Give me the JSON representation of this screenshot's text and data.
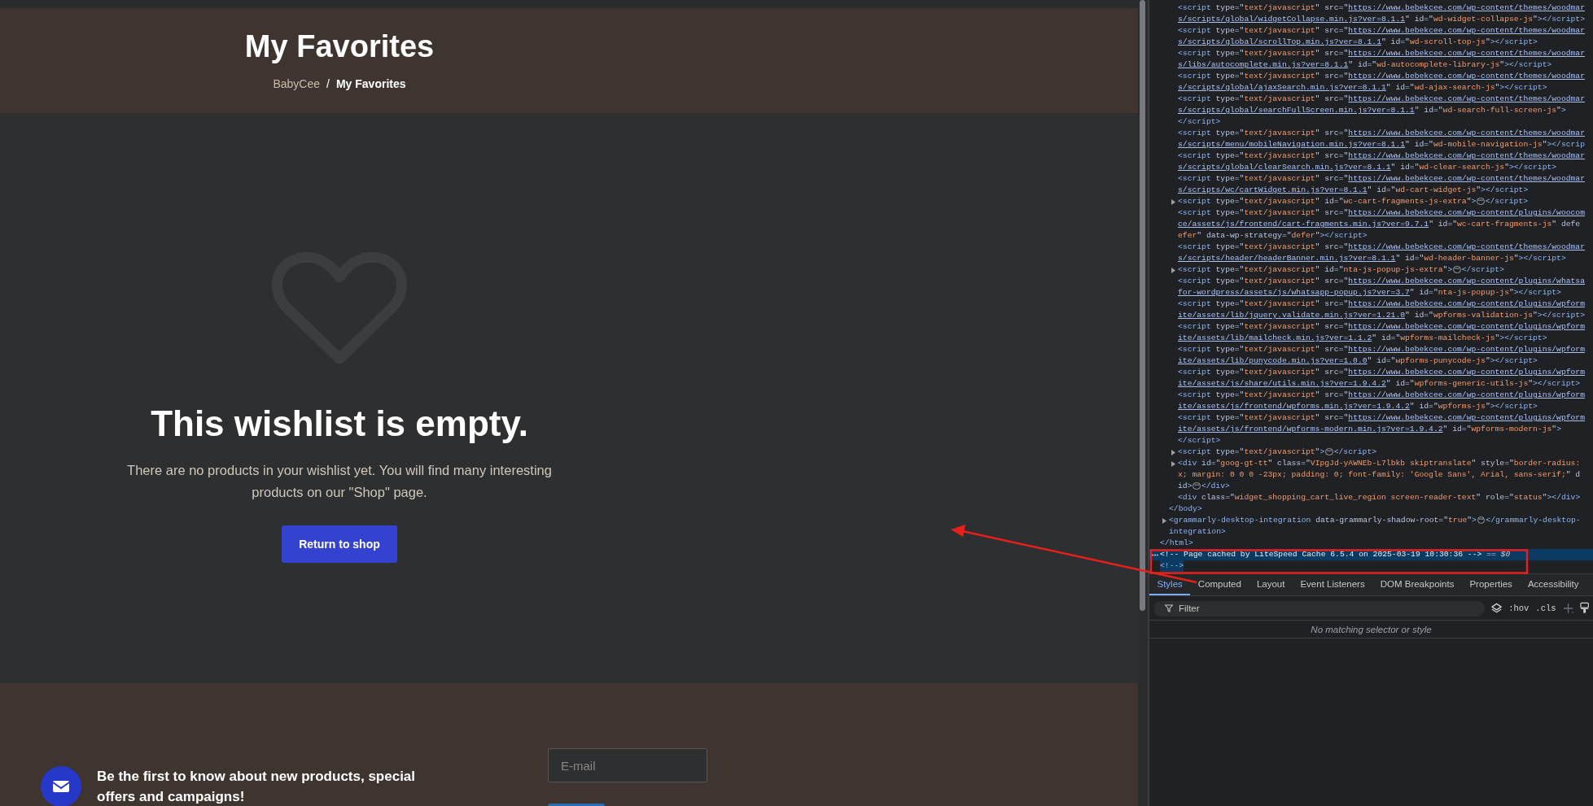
{
  "page": {
    "header": {
      "title": "My Favorites",
      "breadcrumb": [
        {
          "label": "BabyCee",
          "current": false
        },
        {
          "label": "My Favorites",
          "current": true
        }
      ],
      "breadcrumb_separator": "/"
    },
    "empty_state": {
      "heading": "This wishlist is empty.",
      "message": "There are no products in your wishlist yet. You will find many interesting products on our \"Shop\" page.",
      "button": "Return to shop"
    },
    "newsletter": {
      "text": "Be the first to know about new products, special offers and campaigns!",
      "email_placeholder": "E-mail"
    }
  },
  "devtools": {
    "dom_tree": [
      {
        "children": [
          {
            "children": [
              {
                "selected": false,
                "lines": [
                  [
                    {
                      "kind": "tag",
                      "t": "<script"
                    },
                    {
                      "kind": "attr",
                      "t": " type=\""
                    },
                    {
                      "kind": "val",
                      "t": "text/javascript"
                    },
                    {
                      "kind": "attr",
                      "t": "\" src=\""
                    },
                    {
                      "kind": "link",
                      "t": "https://www.bebekcee.com/wp-content/themes/woodmar"
                    }
                  ],
                  [
                    {
                      "kind": "link",
                      "t": "s/scripts/global/widgetCollapse.min.js?ver=8.1.1"
                    },
                    {
                      "kind": "attr",
                      "t": "\" id=\""
                    },
                    {
                      "kind": "val",
                      "t": "wd-widget-collapse-js"
                    },
                    {
                      "kind": "attr",
                      "t": "\""
                    },
                    {
                      "kind": "tag",
                      "t": "></script>"
                    }
                  ]
                ]
              },
              {
                "selected": false,
                "lines": [
                  [
                    {
                      "kind": "tag",
                      "t": "<script"
                    },
                    {
                      "kind": "attr",
                      "t": " type=\""
                    },
                    {
                      "kind": "val",
                      "t": "text/javascript"
                    },
                    {
                      "kind": "attr",
                      "t": "\" src=\""
                    },
                    {
                      "kind": "link",
                      "t": "https://www.bebekcee.com/wp-content/themes/woodmar"
                    }
                  ],
                  [
                    {
                      "kind": "link",
                      "t": "s/scripts/global/scrollTop.min.js?ver=8.1.1"
                    },
                    {
                      "kind": "attr",
                      "t": "\" id=\""
                    },
                    {
                      "kind": "val",
                      "t": "wd-scroll-top-js"
                    },
                    {
                      "kind": "attr",
                      "t": "\""
                    },
                    {
                      "kind": "tag",
                      "t": "></script>"
                    }
                  ]
                ]
              },
              {
                "selected": false,
                "lines": [
                  [
                    {
                      "kind": "tag",
                      "t": "<script"
                    },
                    {
                      "kind": "attr",
                      "t": " type=\""
                    },
                    {
                      "kind": "val",
                      "t": "text/javascript"
                    },
                    {
                      "kind": "attr",
                      "t": "\" src=\""
                    },
                    {
                      "kind": "link",
                      "t": "https://www.bebekcee.com/wp-content/themes/woodmar"
                    }
                  ],
                  [
                    {
                      "kind": "link",
                      "t": "s/libs/autocomplete.min.js?ver=8.1.1"
                    },
                    {
                      "kind": "attr",
                      "t": "\" id=\""
                    },
                    {
                      "kind": "val",
                      "t": "wd-autocomplete-library-js"
                    },
                    {
                      "kind": "attr",
                      "t": "\""
                    },
                    {
                      "kind": "tag",
                      "t": "></script>"
                    }
                  ]
                ]
              },
              {
                "selected": false,
                "lines": [
                  [
                    {
                      "kind": "tag",
                      "t": "<script"
                    },
                    {
                      "kind": "attr",
                      "t": " type=\""
                    },
                    {
                      "kind": "val",
                      "t": "text/javascript"
                    },
                    {
                      "kind": "attr",
                      "t": "\" src=\""
                    },
                    {
                      "kind": "link",
                      "t": "https://www.bebekcee.com/wp-content/themes/woodmar"
                    }
                  ],
                  [
                    {
                      "kind": "link",
                      "t": "s/scripts/global/ajaxSearch.min.js?ver=8.1.1"
                    },
                    {
                      "kind": "attr",
                      "t": "\" id=\""
                    },
                    {
                      "kind": "val",
                      "t": "wd-ajax-search-js"
                    },
                    {
                      "kind": "attr",
                      "t": "\""
                    },
                    {
                      "kind": "tag",
                      "t": "></script>"
                    }
                  ]
                ]
              },
              {
                "selected": false,
                "lines": [
                  [
                    {
                      "kind": "tag",
                      "t": "<script"
                    },
                    {
                      "kind": "attr",
                      "t": " type=\""
                    },
                    {
                      "kind": "val",
                      "t": "text/javascript"
                    },
                    {
                      "kind": "attr",
                      "t": "\" src=\""
                    },
                    {
                      "kind": "link",
                      "t": "https://www.bebekcee.com/wp-content/themes/woodmar"
                    }
                  ],
                  [
                    {
                      "kind": "link",
                      "t": "s/scripts/global/searchFullScreen.min.js?ver=8.1.1"
                    },
                    {
                      "kind": "attr",
                      "t": "\" id=\""
                    },
                    {
                      "kind": "val",
                      "t": "wd-search-full-screen-js"
                    },
                    {
                      "kind": "attr",
                      "t": "\""
                    },
                    {
                      "kind": "tag",
                      "t": ">"
                    }
                  ],
                  [
                    {
                      "kind": "tag",
                      "t": "</script>"
                    }
                  ]
                ]
              },
              {
                "selected": false,
                "lines": [
                  [
                    {
                      "kind": "tag",
                      "t": "<script"
                    },
                    {
                      "kind": "attr",
                      "t": " type=\""
                    },
                    {
                      "kind": "val",
                      "t": "text/javascript"
                    },
                    {
                      "kind": "attr",
                      "t": "\" src=\""
                    },
                    {
                      "kind": "link",
                      "t": "https://www.bebekcee.com/wp-content/themes/woodmar"
                    }
                  ],
                  [
                    {
                      "kind": "link",
                      "t": "s/scripts/menu/mobileNavigation.min.js?ver=8.1.1"
                    },
                    {
                      "kind": "attr",
                      "t": "\" id=\""
                    },
                    {
                      "kind": "val",
                      "t": "wd-mobile-navigation-js"
                    },
                    {
                      "kind": "attr",
                      "t": "\""
                    },
                    {
                      "kind": "tag",
                      "t": "></scrip"
                    }
                  ]
                ]
              },
              {
                "selected": false,
                "lines": [
                  [
                    {
                      "kind": "tag",
                      "t": "<script"
                    },
                    {
                      "kind": "attr",
                      "t": " type=\""
                    },
                    {
                      "kind": "val",
                      "t": "text/javascript"
                    },
                    {
                      "kind": "attr",
                      "t": "\" src=\""
                    },
                    {
                      "kind": "link",
                      "t": "https://www.bebekcee.com/wp-content/themes/woodmar"
                    }
                  ],
                  [
                    {
                      "kind": "link",
                      "t": "s/scripts/global/clearSearch.min.js?ver=8.1.1"
                    },
                    {
                      "kind": "attr",
                      "t": "\" id=\""
                    },
                    {
                      "kind": "val",
                      "t": "wd-clear-search-js"
                    },
                    {
                      "kind": "attr",
                      "t": "\""
                    },
                    {
                      "kind": "tag",
                      "t": "></script>"
                    }
                  ]
                ]
              },
              {
                "selected": false,
                "lines": [
                  [
                    {
                      "kind": "tag",
                      "t": "<script"
                    },
                    {
                      "kind": "attr",
                      "t": " type=\""
                    },
                    {
                      "kind": "val",
                      "t": "text/javascript"
                    },
                    {
                      "kind": "attr",
                      "t": "\" src=\""
                    },
                    {
                      "kind": "link",
                      "t": "https://www.bebekcee.com/wp-content/themes/woodmar"
                    }
                  ],
                  [
                    {
                      "kind": "link",
                      "t": "s/scripts/wc/cartWidget.min.js?ver=8.1.1"
                    },
                    {
                      "kind": "attr",
                      "t": "\" id=\""
                    },
                    {
                      "kind": "val",
                      "t": "wd-cart-widget-js"
                    },
                    {
                      "kind": "attr",
                      "t": "\""
                    },
                    {
                      "kind": "tag",
                      "t": "></script>"
                    }
                  ]
                ]
              },
              {
                "selected": false,
                "expanded": false,
                "lines": [
                  [
                    {
                      "kind": "tag",
                      "t": "<script"
                    },
                    {
                      "kind": "attr",
                      "t": " type=\""
                    },
                    {
                      "kind": "val",
                      "t": "text/javascript"
                    },
                    {
                      "kind": "attr",
                      "t": "\" id=\""
                    },
                    {
                      "kind": "val",
                      "t": "wc-cart-fragments-js-extra"
                    },
                    {
                      "kind": "attr",
                      "t": "\""
                    },
                    {
                      "kind": "tag",
                      "t": ">"
                    },
                    {
                      "kind": "more",
                      "t": "⋯"
                    },
                    {
                      "kind": "tag",
                      "t": "</script>"
                    }
                  ]
                ]
              },
              {
                "selected": false,
                "lines": [
                  [
                    {
                      "kind": "tag",
                      "t": "<script"
                    },
                    {
                      "kind": "attr",
                      "t": " type=\""
                    },
                    {
                      "kind": "val",
                      "t": "text/javascript"
                    },
                    {
                      "kind": "attr",
                      "t": "\" src=\""
                    },
                    {
                      "kind": "link",
                      "t": "https://www.bebekcee.com/wp-content/plugins/woocom"
                    }
                  ],
                  [
                    {
                      "kind": "link",
                      "t": "ce/assets/js/frontend/cart-fragments.min.js?ver=9.7.1"
                    },
                    {
                      "kind": "attr",
                      "t": "\" id=\""
                    },
                    {
                      "kind": "val",
                      "t": "wc-cart-fragments-js"
                    },
                    {
                      "kind": "attr",
                      "t": "\" defe"
                    }
                  ],
                  [
                    {
                      "kind": "val",
                      "t": "efer"
                    },
                    {
                      "kind": "attr",
                      "t": "\" data-wp-strategy=\""
                    },
                    {
                      "kind": "val",
                      "t": "defer"
                    },
                    {
                      "kind": "attr",
                      "t": "\""
                    },
                    {
                      "kind": "tag",
                      "t": "></script>"
                    }
                  ]
                ]
              },
              {
                "selected": false,
                "lines": [
                  [
                    {
                      "kind": "tag",
                      "t": "<script"
                    },
                    {
                      "kind": "attr",
                      "t": " type=\""
                    },
                    {
                      "kind": "val",
                      "t": "text/javascript"
                    },
                    {
                      "kind": "attr",
                      "t": "\" src=\""
                    },
                    {
                      "kind": "link",
                      "t": "https://www.bebekcee.com/wp-content/themes/woodmar"
                    }
                  ],
                  [
                    {
                      "kind": "link",
                      "t": "s/scripts/header/headerBanner.min.js?ver=8.1.1"
                    },
                    {
                      "kind": "attr",
                      "t": "\" id=\""
                    },
                    {
                      "kind": "val",
                      "t": "wd-header-banner-js"
                    },
                    {
                      "kind": "attr",
                      "t": "\""
                    },
                    {
                      "kind": "tag",
                      "t": "></script>"
                    }
                  ]
                ]
              },
              {
                "selected": false,
                "expanded": false,
                "lines": [
                  [
                    {
                      "kind": "tag",
                      "t": "<script"
                    },
                    {
                      "kind": "attr",
                      "t": " type=\""
                    },
                    {
                      "kind": "val",
                      "t": "text/javascript"
                    },
                    {
                      "kind": "attr",
                      "t": "\" id=\""
                    },
                    {
                      "kind": "val",
                      "t": "nta-js-popup-js-extra"
                    },
                    {
                      "kind": "attr",
                      "t": "\""
                    },
                    {
                      "kind": "tag",
                      "t": ">"
                    },
                    {
                      "kind": "more",
                      "t": "⋯"
                    },
                    {
                      "kind": "tag",
                      "t": "</script>"
                    }
                  ]
                ]
              },
              {
                "selected": false,
                "lines": [
                  [
                    {
                      "kind": "tag",
                      "t": "<script"
                    },
                    {
                      "kind": "attr",
                      "t": " type=\""
                    },
                    {
                      "kind": "val",
                      "t": "text/javascript"
                    },
                    {
                      "kind": "attr",
                      "t": "\" src=\""
                    },
                    {
                      "kind": "link",
                      "t": "https://www.bebekcee.com/wp-content/plugins/whatsa"
                    }
                  ],
                  [
                    {
                      "kind": "link",
                      "t": "for-wordpress/assets/js/whatsapp-popup.js?ver=3.7"
                    },
                    {
                      "kind": "attr",
                      "t": "\" id=\""
                    },
                    {
                      "kind": "val",
                      "t": "nta-js-popup-js"
                    },
                    {
                      "kind": "attr",
                      "t": "\""
                    },
                    {
                      "kind": "tag",
                      "t": "></script>"
                    }
                  ]
                ]
              },
              {
                "selected": false,
                "lines": [
                  [
                    {
                      "kind": "tag",
                      "t": "<script"
                    },
                    {
                      "kind": "attr",
                      "t": " type=\""
                    },
                    {
                      "kind": "val",
                      "t": "text/javascript"
                    },
                    {
                      "kind": "attr",
                      "t": "\" src=\""
                    },
                    {
                      "kind": "link",
                      "t": "https://www.bebekcee.com/wp-content/plugins/wpform"
                    }
                  ],
                  [
                    {
                      "kind": "link",
                      "t": "ite/assets/lib/jquery.validate.min.js?ver=1.21.0"
                    },
                    {
                      "kind": "attr",
                      "t": "\" id=\""
                    },
                    {
                      "kind": "val",
                      "t": "wpforms-validation-js"
                    },
                    {
                      "kind": "attr",
                      "t": "\""
                    },
                    {
                      "kind": "tag",
                      "t": "></script>"
                    }
                  ]
                ]
              },
              {
                "selected": false,
                "lines": [
                  [
                    {
                      "kind": "tag",
                      "t": "<script"
                    },
                    {
                      "kind": "attr",
                      "t": " type=\""
                    },
                    {
                      "kind": "val",
                      "t": "text/javascript"
                    },
                    {
                      "kind": "attr",
                      "t": "\" src=\""
                    },
                    {
                      "kind": "link",
                      "t": "https://www.bebekcee.com/wp-content/plugins/wpform"
                    }
                  ],
                  [
                    {
                      "kind": "link",
                      "t": "ite/assets/lib/mailcheck.min.js?ver=1.1.2"
                    },
                    {
                      "kind": "attr",
                      "t": "\" id=\""
                    },
                    {
                      "kind": "val",
                      "t": "wpforms-mailcheck-js"
                    },
                    {
                      "kind": "attr",
                      "t": "\""
                    },
                    {
                      "kind": "tag",
                      "t": "></script>"
                    }
                  ]
                ]
              },
              {
                "selected": false,
                "lines": [
                  [
                    {
                      "kind": "tag",
                      "t": "<script"
                    },
                    {
                      "kind": "attr",
                      "t": " type=\""
                    },
                    {
                      "kind": "val",
                      "t": "text/javascript"
                    },
                    {
                      "kind": "attr",
                      "t": "\" src=\""
                    },
                    {
                      "kind": "link",
                      "t": "https://www.bebekcee.com/wp-content/plugins/wpform"
                    }
                  ],
                  [
                    {
                      "kind": "link",
                      "t": "ite/assets/lib/punycode.min.js?ver=1.0.0"
                    },
                    {
                      "kind": "attr",
                      "t": "\" id=\""
                    },
                    {
                      "kind": "val",
                      "t": "wpforms-punycode-js"
                    },
                    {
                      "kind": "attr",
                      "t": "\""
                    },
                    {
                      "kind": "tag",
                      "t": "></script>"
                    }
                  ]
                ]
              },
              {
                "selected": false,
                "lines": [
                  [
                    {
                      "kind": "tag",
                      "t": "<script"
                    },
                    {
                      "kind": "attr",
                      "t": " type=\""
                    },
                    {
                      "kind": "val",
                      "t": "text/javascript"
                    },
                    {
                      "kind": "attr",
                      "t": "\" src=\""
                    },
                    {
                      "kind": "link",
                      "t": "https://www.bebekcee.com/wp-content/plugins/wpform"
                    }
                  ],
                  [
                    {
                      "kind": "link",
                      "t": "ite/assets/js/share/utils.min.js?ver=1.9.4.2"
                    },
                    {
                      "kind": "attr",
                      "t": "\" id=\""
                    },
                    {
                      "kind": "val",
                      "t": "wpforms-generic-utils-js"
                    },
                    {
                      "kind": "attr",
                      "t": "\""
                    },
                    {
                      "kind": "tag",
                      "t": "></script>"
                    }
                  ]
                ]
              },
              {
                "selected": false,
                "lines": [
                  [
                    {
                      "kind": "tag",
                      "t": "<script"
                    },
                    {
                      "kind": "attr",
                      "t": " type=\""
                    },
                    {
                      "kind": "val",
                      "t": "text/javascript"
                    },
                    {
                      "kind": "attr",
                      "t": "\" src=\""
                    },
                    {
                      "kind": "link",
                      "t": "https://www.bebekcee.com/wp-content/plugins/wpform"
                    }
                  ],
                  [
                    {
                      "kind": "link",
                      "t": "ite/assets/js/frontend/wpforms.min.js?ver=1.9.4.2"
                    },
                    {
                      "kind": "attr",
                      "t": "\" id=\""
                    },
                    {
                      "kind": "val",
                      "t": "wpforms-js"
                    },
                    {
                      "kind": "attr",
                      "t": "\""
                    },
                    {
                      "kind": "tag",
                      "t": "></script>"
                    }
                  ]
                ]
              },
              {
                "selected": false,
                "lines": [
                  [
                    {
                      "kind": "tag",
                      "t": "<script"
                    },
                    {
                      "kind": "attr",
                      "t": " type=\""
                    },
                    {
                      "kind": "val",
                      "t": "text/javascript"
                    },
                    {
                      "kind": "attr",
                      "t": "\" src=\""
                    },
                    {
                      "kind": "link",
                      "t": "https://www.bebekcee.com/wp-content/plugins/wpform"
                    }
                  ],
                  [
                    {
                      "kind": "link",
                      "t": "ite/assets/js/frontend/wpforms-modern.min.js?ver=1.9.4.2"
                    },
                    {
                      "kind": "attr",
                      "t": "\" id=\""
                    },
                    {
                      "kind": "val",
                      "t": "wpforms-modern-js"
                    },
                    {
                      "kind": "attr",
                      "t": "\""
                    },
                    {
                      "kind": "tag",
                      "t": ">"
                    }
                  ],
                  [
                    {
                      "kind": "tag",
                      "t": "</script>"
                    }
                  ]
                ]
              },
              {
                "selected": false,
                "expanded": false,
                "lines": [
                  [
                    {
                      "kind": "tag",
                      "t": "<script"
                    },
                    {
                      "kind": "attr",
                      "t": " type=\""
                    },
                    {
                      "kind": "val",
                      "t": "text/javascript"
                    },
                    {
                      "kind": "attr",
                      "t": "\""
                    },
                    {
                      "kind": "tag",
                      "t": ">"
                    },
                    {
                      "kind": "more",
                      "t": "⋯"
                    },
                    {
                      "kind": "tag",
                      "t": "</script>"
                    }
                  ]
                ]
              },
              {
                "selected": false,
                "expanded": false,
                "lines": [
                  [
                    {
                      "kind": "tag",
                      "t": "<div"
                    },
                    {
                      "kind": "attr",
                      "t": " id=\""
                    },
                    {
                      "kind": "val",
                      "t": "goog-gt-tt"
                    },
                    {
                      "kind": "attr",
                      "t": "\" class=\""
                    },
                    {
                      "kind": "val",
                      "t": "VIpgJd-yAWNEb-L7lbkb skiptranslate"
                    },
                    {
                      "kind": "attr",
                      "t": "\" style=\""
                    },
                    {
                      "kind": "val",
                      "t": "border-radius:"
                    }
                  ],
                  [
                    {
                      "kind": "val",
                      "t": "x; margin: 0 0 0 -23px; padding: 0; font-family: 'Google Sans', Arial, sans-serif;"
                    },
                    {
                      "kind": "attr",
                      "t": "\" d"
                    }
                  ],
                  [
                    {
                      "kind": "attr",
                      "t": "id"
                    },
                    {
                      "kind": "tag",
                      "t": ">"
                    },
                    {
                      "kind": "more",
                      "t": "⋯"
                    },
                    {
                      "kind": "tag",
                      "t": "</div>"
                    }
                  ]
                ]
              },
              {
                "selected": false,
                "lines": [
                  [
                    {
                      "kind": "tag",
                      "t": "<div"
                    },
                    {
                      "kind": "attr",
                      "t": " class=\""
                    },
                    {
                      "kind": "val",
                      "t": "widget_shopping_cart_live_region screen-reader-text"
                    },
                    {
                      "kind": "attr",
                      "t": "\" role=\""
                    },
                    {
                      "kind": "val",
                      "t": "status"
                    },
                    {
                      "kind": "attr",
                      "t": "\""
                    },
                    {
                      "kind": "tag",
                      "t": "></div>"
                    }
                  ]
                ]
              }
            ]
          },
          {
            "selected": false,
            "lines": [
              [
                {
                  "kind": "tag",
                  "t": "</body>"
                }
              ]
            ]
          },
          {
            "selected": false,
            "expanded": false,
            "lines": [
              [
                {
                  "kind": "tag",
                  "t": "<grammarly-desktop-integration"
                },
                {
                  "kind": "attr",
                  "t": " data-grammarly-shadow-root=\""
                },
                {
                  "kind": "val",
                  "t": "true"
                },
                {
                  "kind": "attr",
                  "t": "\""
                },
                {
                  "kind": "tag",
                  "t": ">"
                },
                {
                  "kind": "more",
                  "t": "⋯"
                },
                {
                  "kind": "tag",
                  "t": "</grammarly-desktop-"
                }
              ],
              [
                {
                  "kind": "tag",
                  "t": "integration>"
                }
              ]
            ]
          }
        ]
      },
      {
        "selected": false,
        "lines": [
          [
            {
              "kind": "tag",
              "t": "</html>"
            }
          ]
        ]
      },
      {
        "selected": true,
        "lines": [
          [
            {
              "kind": "comment",
              "t": "<!-- Page cached by LiteSpeed Cache 6.5.4 on 2025-03-19 10:30:36 -->"
            },
            {
              "kind": "text",
              "t": " == "
            },
            {
              "kind": "var",
              "t": "$0"
            }
          ],
          [
            {
              "kind": "tag",
              "t": "<!-->"
            }
          ]
        ]
      }
    ],
    "styles_pane": {
      "tabs": [
        {
          "label": "Styles",
          "selected": true
        },
        {
          "label": "Computed",
          "selected": false
        },
        {
          "label": "Layout",
          "selected": false
        },
        {
          "label": "Event Listeners",
          "selected": false
        },
        {
          "label": "DOM Breakpoints",
          "selected": false
        },
        {
          "label": "Properties",
          "selected": false
        },
        {
          "label": "Accessibility",
          "selected": false
        }
      ],
      "filter_placeholder": "Filter",
      "toggles": [
        ":hov",
        ".cls"
      ],
      "empty_message": "No matching selector or style"
    }
  }
}
